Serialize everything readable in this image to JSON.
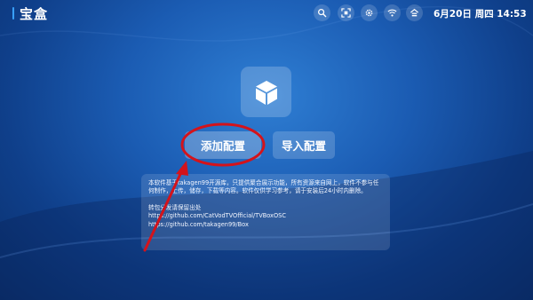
{
  "header": {
    "title": "宝盒",
    "date": "6月20日",
    "weekday": "周四",
    "time": "14:53",
    "icons": [
      "search-icon",
      "scan-icon",
      "settings-icon",
      "wifi-icon",
      "home-icon"
    ]
  },
  "main": {
    "app_icon": "cube-icon",
    "add_config_label": "添加配置",
    "import_config_label": "导入配置"
  },
  "info": {
    "line1": "本软件基于takagen99开源库，只提供聚合展示功能，所有资源来自网上，软件不参与任何制作，上传，储存，下载等内容。软件仅供学习参考，请于安装后24小时内删除。",
    "line2": "转包分发请保留出处",
    "link1": "https://github.com/CatVodTVOfficial/TVBoxOSC",
    "link2": "https://github.com/takagen99/Box"
  },
  "annotation": {
    "circle_color": "#d4131b",
    "arrow_color": "#d4131b"
  }
}
